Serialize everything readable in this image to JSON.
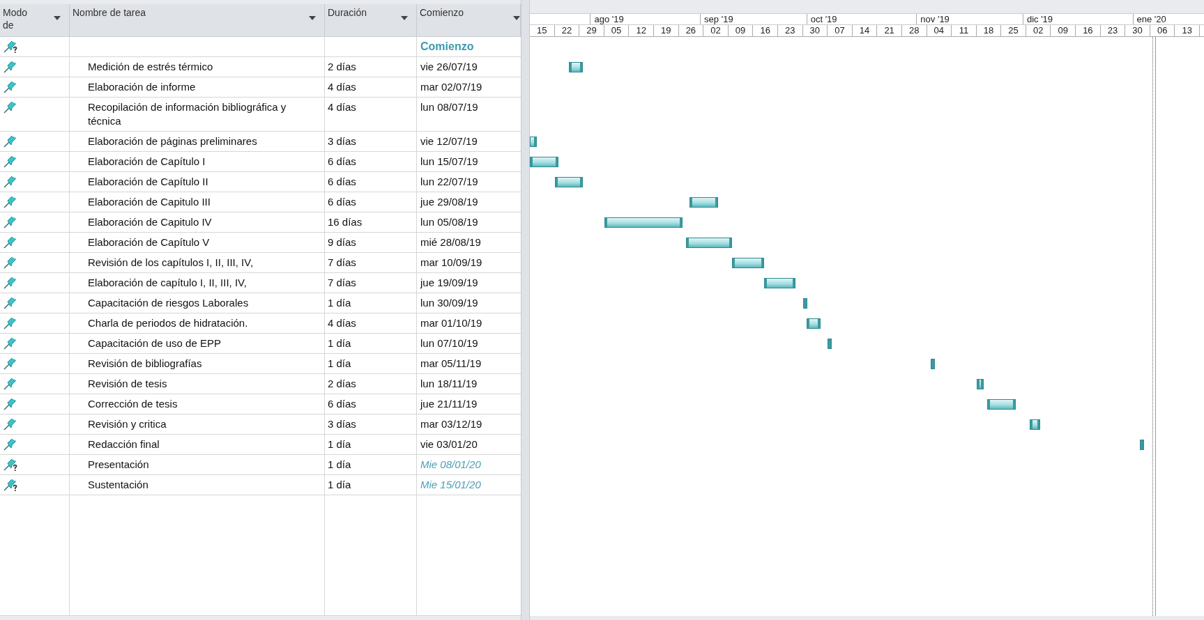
{
  "columns": [
    {
      "label": "Modo de"
    },
    {
      "label": "Nombre de tarea"
    },
    {
      "label": "Duración"
    },
    {
      "label": "Comienzo"
    }
  ],
  "timescale": {
    "months": [
      "ago '19",
      "sep '19",
      "oct '19",
      "nov '19",
      "dic '19",
      "ene '20"
    ],
    "weeks": [
      "15",
      "22",
      "29",
      "05",
      "12",
      "19",
      "26",
      "02",
      "09",
      "16",
      "23",
      "30",
      "07",
      "14",
      "21",
      "28",
      "04",
      "11",
      "18",
      "25",
      "02",
      "09",
      "16",
      "23",
      "30",
      "06",
      "13"
    ]
  },
  "tasks": [
    {
      "kind": "start_marker",
      "start": "Comienzo"
    },
    {
      "kind": "auto",
      "name": "Medición de estrés térmico",
      "duration": "2 días",
      "start": "vie 26/07/19"
    },
    {
      "kind": "auto",
      "name": "Elaboración de informe",
      "duration": "4 días",
      "start": "mar 02/07/19"
    },
    {
      "kind": "auto",
      "name": "Recopilación de información bibliográfica y técnica",
      "duration": "4 días",
      "start": "lun 08/07/19"
    },
    {
      "kind": "auto",
      "name": "Elaboración de páginas preliminares",
      "duration": "3 días",
      "start": "vie 12/07/19"
    },
    {
      "kind": "auto",
      "name": "Elaboración de Capítulo I",
      "duration": "6 días",
      "start": "lun 15/07/19"
    },
    {
      "kind": "auto",
      "name": "Elaboración de Capítulo II",
      "duration": "6 días",
      "start": "lun 22/07/19"
    },
    {
      "kind": "auto",
      "name": "Elaboración de Capitulo III",
      "duration": "6 días",
      "start": "jue 29/08/19"
    },
    {
      "kind": "auto",
      "name": "Elaboración de Capitulo IV",
      "duration": "16 días",
      "start": "lun 05/08/19"
    },
    {
      "kind": "auto",
      "name": "Elaboración de Capítulo V",
      "duration": "9 días",
      "start": "mié 28/08/19"
    },
    {
      "kind": "auto",
      "name": "Revisión de los capítulos I, II, III, IV,",
      "duration": "7 días",
      "start": "mar 10/09/19"
    },
    {
      "kind": "auto",
      "name": "Elaboración de capítulo I, II, III, IV,",
      "duration": "7 días",
      "start": "jue 19/09/19"
    },
    {
      "kind": "auto",
      "name": "Capacitación de riesgos Laborales",
      "duration": "1 día",
      "start": "lun 30/09/19"
    },
    {
      "kind": "auto",
      "name": "Charla de periodos de hidratación.",
      "duration": "4 días",
      "start": "mar 01/10/19"
    },
    {
      "kind": "auto",
      "name": "Capacitación de uso de EPP",
      "duration": "1 día",
      "start": "lun 07/10/19"
    },
    {
      "kind": "auto",
      "name": "Revisión de bibliografías",
      "duration": "1 día",
      "start": "mar 05/11/19"
    },
    {
      "kind": "auto",
      "name": "Revisión de tesis",
      "duration": "2 días",
      "start": "lun 18/11/19"
    },
    {
      "kind": "auto",
      "name": "Corrección de tesis",
      "duration": "6 días",
      "start": "jue 21/11/19"
    },
    {
      "kind": "auto",
      "name": "Revisión y critica",
      "duration": "3 días",
      "start": "mar 03/12/19"
    },
    {
      "kind": "auto",
      "name": "Redacción final",
      "duration": "1 día",
      "start": "vie 03/01/20"
    },
    {
      "kind": "manual",
      "name": "Presentación",
      "duration": "1 día",
      "start": "Mie 08/01/20"
    },
    {
      "kind": "manual",
      "name": "Sustentación",
      "duration": "1 día",
      "start": "Mie 15/01/20"
    }
  ]
}
